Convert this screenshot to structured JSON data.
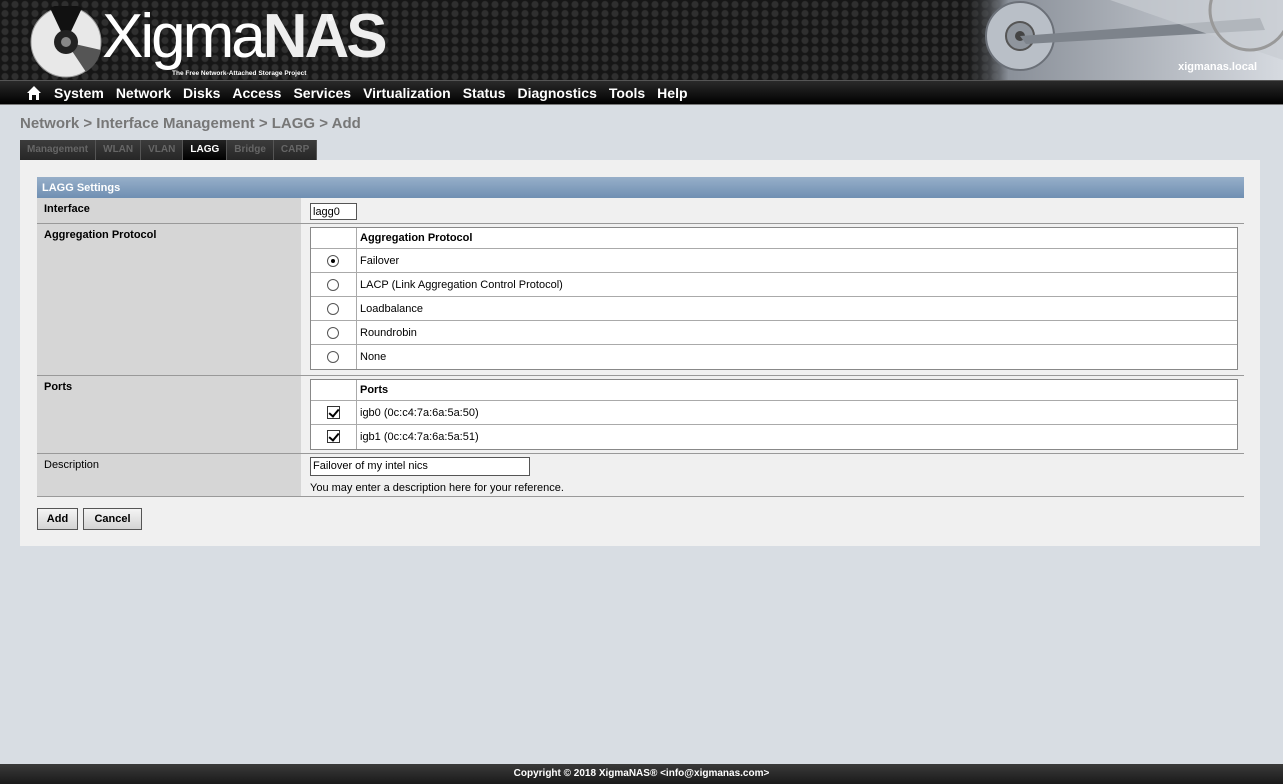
{
  "header": {
    "logo_text_a": "Xigma",
    "logo_text_b": "NAS",
    "logo_reg": "®",
    "tagline": "The Free Network-Attached Storage Project",
    "hostname": "xigmanas.local"
  },
  "nav": {
    "items": [
      "System",
      "Network",
      "Disks",
      "Access",
      "Services",
      "Virtualization",
      "Status",
      "Diagnostics",
      "Tools",
      "Help"
    ]
  },
  "breadcrumb": "Network > Interface Management > LAGG > Add",
  "tabs": [
    {
      "label": "Management",
      "active": false
    },
    {
      "label": "WLAN",
      "active": false
    },
    {
      "label": "VLAN",
      "active": false
    },
    {
      "label": "LAGG",
      "active": true
    },
    {
      "label": "Bridge",
      "active": false
    },
    {
      "label": "CARP",
      "active": false
    }
  ],
  "settings": {
    "section_title": "LAGG Settings",
    "interface": {
      "label": "Interface",
      "value": "lagg0"
    },
    "protocol": {
      "label": "Aggregation Protocol",
      "header": "Aggregation Protocol",
      "options": [
        {
          "label": "Failover",
          "selected": true
        },
        {
          "label": "LACP (Link Aggregation Control Protocol)",
          "selected": false
        },
        {
          "label": "Loadbalance",
          "selected": false
        },
        {
          "label": "Roundrobin",
          "selected": false
        },
        {
          "label": "None",
          "selected": false
        }
      ]
    },
    "ports": {
      "label": "Ports",
      "header": "Ports",
      "items": [
        {
          "label": "igb0 (0c:c4:7a:6a:5a:50)",
          "checked": true
        },
        {
          "label": "igb1 (0c:c4:7a:6a:5a:51)",
          "checked": true
        }
      ]
    },
    "description": {
      "label": "Description",
      "value": "Failover of my intel nics",
      "hint": "You may enter a description here for your reference."
    }
  },
  "buttons": {
    "add": "Add",
    "cancel": "Cancel"
  },
  "footer": "Copyright © 2018 XigmaNAS® <info@xigmanas.com>",
  "colors": {
    "section_header": "#7f9bbd",
    "nav_bg": "#111111",
    "page_bg": "#d8dde3"
  }
}
